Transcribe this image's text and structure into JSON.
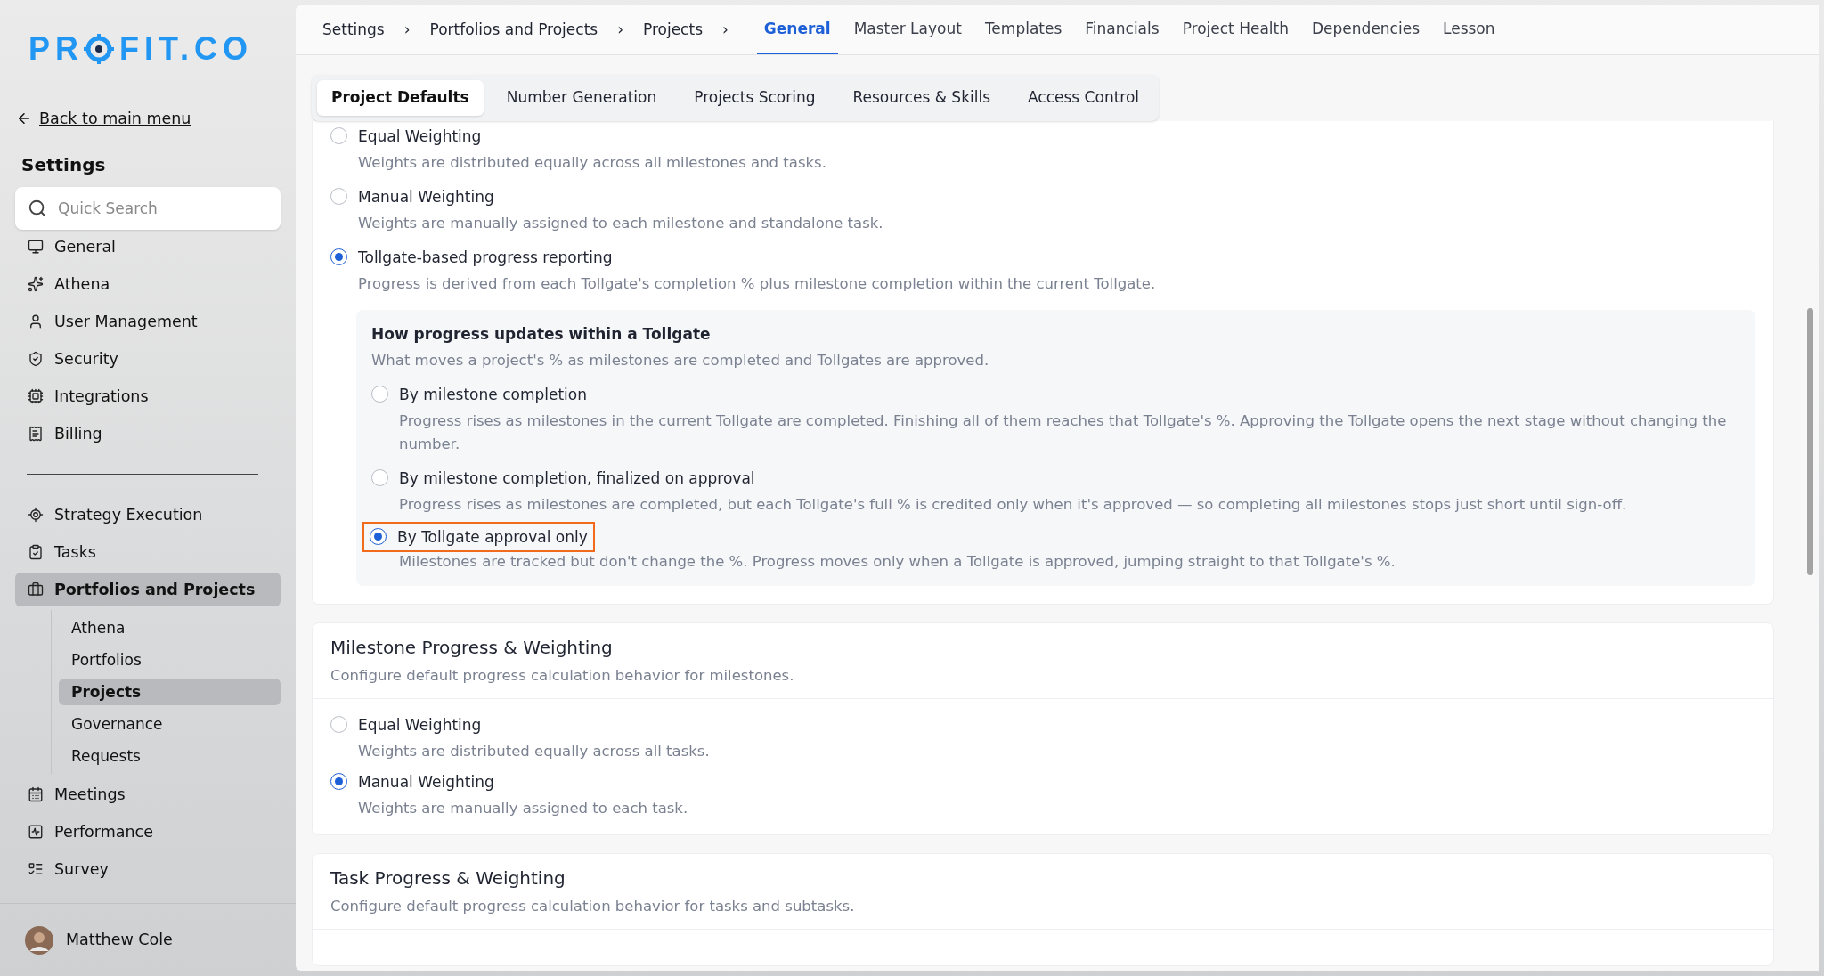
{
  "logo": {
    "before_mark": "PR",
    "after_mark": "FIT.CO"
  },
  "back_link": "Back to main menu",
  "sidebar": {
    "title": "Settings",
    "search": {
      "placeholder": "Quick Search"
    },
    "groups": [
      [
        {
          "label": "General",
          "selected": false
        },
        {
          "label": "Athena",
          "selected": false
        },
        {
          "label": "User Management",
          "selected": false
        },
        {
          "label": "Security",
          "selected": false
        },
        {
          "label": "Integrations",
          "selected": false
        },
        {
          "label": "Billing",
          "selected": false
        }
      ],
      [
        {
          "label": "Strategy Execution",
          "selected": false
        },
        {
          "label": "Tasks",
          "selected": false
        },
        {
          "label": "Portfolios and Projects",
          "selected": true,
          "children": [
            {
              "label": "Athena",
              "selected": false
            },
            {
              "label": "Portfolios",
              "selected": false
            },
            {
              "label": "Projects",
              "selected": true
            },
            {
              "label": "Governance",
              "selected": false
            },
            {
              "label": "Requests",
              "selected": false
            }
          ]
        },
        {
          "label": "Meetings",
          "selected": false
        },
        {
          "label": "Performance",
          "selected": false
        },
        {
          "label": "Survey",
          "selected": false
        }
      ]
    ],
    "user": {
      "name": "Matthew Cole"
    }
  },
  "breadcrumb": [
    "Settings",
    "Portfolios and Projects",
    "Projects"
  ],
  "breadcrumb_separator": "›",
  "tabs": [
    {
      "label": "General",
      "selected": true
    },
    {
      "label": "Master Layout",
      "selected": false
    },
    {
      "label": "Templates",
      "selected": false
    },
    {
      "label": "Financials",
      "selected": false
    },
    {
      "label": "Project Health",
      "selected": false
    },
    {
      "label": "Dependencies",
      "selected": false
    },
    {
      "label": "Lesson",
      "selected": false
    }
  ],
  "subtabs": [
    {
      "label": "Project Defaults",
      "selected": true
    },
    {
      "label": "Number Generation",
      "selected": false
    },
    {
      "label": "Projects Scoring",
      "selected": false
    },
    {
      "label": "Resources & Skills",
      "selected": false
    },
    {
      "label": "Access Control",
      "selected": false
    }
  ],
  "project_progress": {
    "options": [
      {
        "label": "Equal Weighting",
        "description": "Weights are distributed equally across all milestones and tasks.",
        "selected": false
      },
      {
        "label": "Manual Weighting",
        "description": "Weights are manually assigned to each milestone and standalone task.",
        "selected": false
      },
      {
        "label": "Tollgate-based progress reporting",
        "description": "Progress is derived from each Tollgate's completion % plus milestone completion within the current Tollgate.",
        "selected": true
      }
    ],
    "tollgate_panel": {
      "title": "How progress updates within a Tollgate",
      "description": "What moves a project's % as milestones are completed and Tollgates are approved.",
      "options": [
        {
          "label": "By milestone completion",
          "description": "Progress rises as milestones in the current Tollgate are completed. Finishing all of them reaches that Tollgate's %. Approving the Tollgate opens the next stage without changing the number.",
          "selected": false,
          "highlighted": false
        },
        {
          "label": "By milestone completion, finalized on approval",
          "description": "Progress rises as milestones are completed, but each Tollgate's full % is credited only when it's approved — so completing all milestones stops just short until sign-off.",
          "selected": false,
          "highlighted": false
        },
        {
          "label": "By Tollgate approval only",
          "description": "Milestones are tracked but don't change the %. Progress moves only when a Tollgate is approved, jumping straight to that Tollgate's %.",
          "selected": true,
          "highlighted": true
        }
      ]
    }
  },
  "sections": [
    {
      "title": "Milestone Progress & Weighting",
      "description": "Configure default progress calculation behavior for milestones.",
      "options": [
        {
          "label": "Equal Weighting",
          "description": "Weights are distributed equally across all tasks.",
          "selected": false
        },
        {
          "label": "Manual Weighting",
          "description": "Weights are manually assigned to each task.",
          "selected": true
        }
      ]
    },
    {
      "title": "Task Progress & Weighting",
      "description": "Configure default progress calculation behavior for tasks and subtasks."
    }
  ]
}
